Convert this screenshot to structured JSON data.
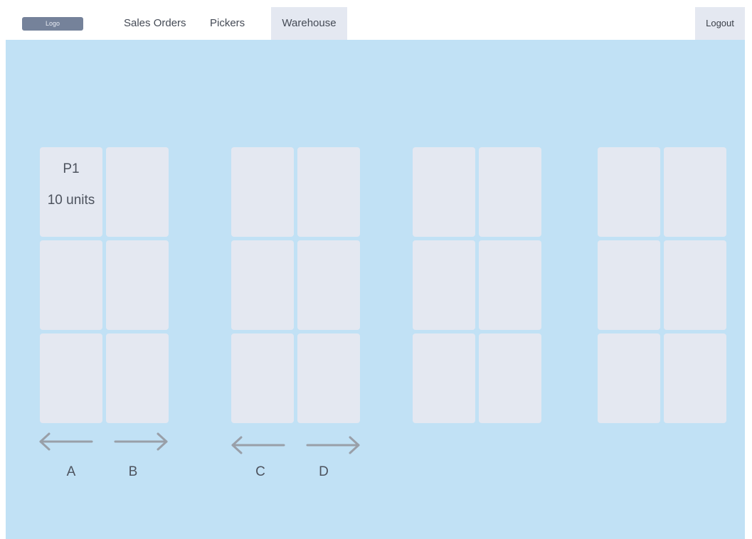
{
  "nav": {
    "logo": "Logo",
    "items": [
      {
        "label": "Sales Orders",
        "active": false
      },
      {
        "label": "Pickers",
        "active": false
      },
      {
        "label": "Warehouse",
        "active": true
      }
    ],
    "logout": "Logout"
  },
  "warehouse": {
    "cells": {
      "p1": {
        "title": "P1",
        "units": "10 units"
      }
    },
    "aisles": [
      "A",
      "B",
      "C",
      "D"
    ]
  },
  "colors": {
    "background": "#c1e1f5",
    "cell": "#e4e8f1",
    "arrow": "#999fa8",
    "logo": "#75829a"
  },
  "icons": {
    "arrow_left": "arrow-left-icon",
    "arrow_right": "arrow-right-icon"
  }
}
